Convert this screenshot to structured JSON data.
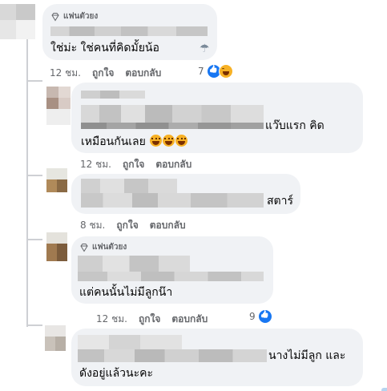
{
  "comments": [
    {
      "fan_badge": "แฟนตัวยง",
      "text_lines": [
        "ใช่ม่ะ ใช่คนที่คิดมั้ยน้อ"
      ],
      "time": "12 ชม.",
      "like_label": "ถูกใจ",
      "reply_label": "ตอบกลับ",
      "reaction_count": "7",
      "emoji": "cloud-rain-icon"
    },
    {
      "text_lines": [
        "แว๊บแรก คิด",
        "เหมือนกันเลย"
      ],
      "time": "12 ชม.",
      "like_label": "ถูกใจ",
      "reply_label": "ตอบกลับ"
    },
    {
      "text_lines": [
        "สตาร์"
      ],
      "time": "8 ชม.",
      "like_label": "ถูกใจ",
      "reply_label": "ตอบกลับ"
    },
    {
      "fan_badge": "แฟนตัวยง",
      "text_lines": [
        "แต่คนนั้นไม่มีลูกน๊า"
      ],
      "time": "12 ชม.",
      "like_label": "ถูกใจ",
      "reply_label": "ตอบกลับ",
      "reaction_count": "9"
    },
    {
      "text_lines": [
        "นางไม่มีลูก และ",
        "ดังอยู่แล้วนะคะ"
      ]
    }
  ],
  "colors": {
    "bubble": "#f0f2f5",
    "meta_text": "#65676b",
    "like_blue": "#1877f2",
    "thread_line": "#ced0d4"
  }
}
